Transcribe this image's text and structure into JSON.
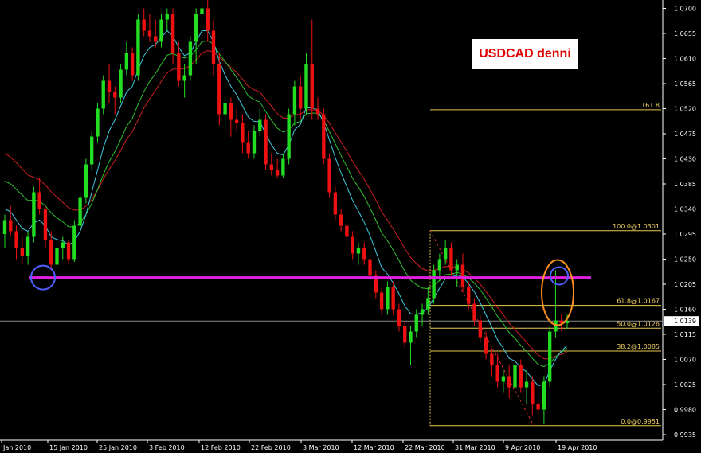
{
  "chart_data": {
    "type": "candlestick",
    "title": "USDCAD denni",
    "y_axis": {
      "ylim": [
        0.9925,
        1.0715
      ],
      "ticks": [
        "1.0700",
        "1.0655",
        "1.0610",
        "1.0565",
        "1.0520",
        "1.0475",
        "1.0430",
        "1.0385",
        "1.0340",
        "1.0295",
        "1.0250",
        "1.0205",
        "1.0160",
        "1.0115",
        "1.0070",
        "1.0025",
        "0.9980",
        "0.9935"
      ]
    },
    "x_axis": {
      "labels": [
        "Jan 2010",
        "15 Jan 2010",
        "25 Jan 2010",
        "3 Feb 2010",
        "12 Feb 2010",
        "22 Feb 2010",
        "3 Mar 2010",
        "12 Mar 2010",
        "22 Mar 2010",
        "31 Mar 2010",
        "9 Apr 2010",
        "19 Apr 2010"
      ]
    },
    "colors": {
      "up": "#22dd22",
      "down": "#ee1111",
      "support": "#e020e0",
      "fib": "#e8c850",
      "ema_fast": "#40c8e0",
      "ema_mid": "#30c030",
      "ema_slow": "#cc2020"
    },
    "candles": [
      [
        1.0295,
        1.033,
        1.027,
        1.032
      ],
      [
        1.032,
        1.0345,
        1.029,
        1.03
      ],
      [
        1.03,
        1.031,
        1.025,
        1.027
      ],
      [
        1.027,
        1.029,
        1.024,
        1.0255
      ],
      [
        1.0255,
        1.03,
        1.024,
        1.029
      ],
      [
        1.029,
        1.038,
        1.028,
        1.037
      ],
      [
        1.037,
        1.0395,
        1.033,
        1.034
      ],
      [
        1.034,
        1.0345,
        1.027,
        1.0285
      ],
      [
        1.0285,
        1.03,
        1.023,
        1.024
      ],
      [
        1.024,
        1.028,
        1.0225,
        1.027
      ],
      [
        1.027,
        1.029,
        1.025,
        1.028
      ],
      [
        1.028,
        1.0285,
        1.024,
        1.025
      ],
      [
        1.025,
        1.032,
        1.0245,
        1.031
      ],
      [
        1.031,
        1.037,
        1.03,
        1.036
      ],
      [
        1.036,
        1.043,
        1.035,
        1.042
      ],
      [
        1.042,
        1.048,
        1.041,
        1.047
      ],
      [
        1.047,
        1.053,
        1.046,
        1.052
      ],
      [
        1.052,
        1.058,
        1.051,
        1.057
      ],
      [
        1.057,
        1.06,
        1.053,
        1.055
      ],
      [
        1.055,
        1.056,
        1.051,
        1.054
      ],
      [
        1.054,
        1.06,
        1.053,
        1.059
      ],
      [
        1.059,
        1.064,
        1.058,
        1.062
      ],
      [
        1.062,
        1.063,
        1.057,
        1.058
      ],
      [
        1.058,
        1.069,
        1.057,
        1.068
      ],
      [
        1.068,
        1.07,
        1.065,
        1.066
      ],
      [
        1.066,
        1.069,
        1.064,
        1.065
      ],
      [
        1.065,
        1.068,
        1.063,
        1.064
      ],
      [
        1.064,
        1.069,
        1.063,
        1.068
      ],
      [
        1.068,
        1.07,
        1.066,
        1.069
      ],
      [
        1.069,
        1.07,
        1.06,
        1.062
      ],
      [
        1.062,
        1.064,
        1.056,
        1.057
      ],
      [
        1.057,
        1.06,
        1.054,
        1.058
      ],
      [
        1.058,
        1.065,
        1.057,
        1.064
      ],
      [
        1.064,
        1.07,
        1.06,
        1.069
      ],
      [
        1.069,
        1.071,
        1.066,
        1.07
      ],
      [
        1.07,
        1.0715,
        1.064,
        1.066
      ],
      [
        1.066,
        1.068,
        1.058,
        1.06
      ],
      [
        1.06,
        1.062,
        1.049,
        1.051
      ],
      [
        1.051,
        1.054,
        1.048,
        1.053
      ],
      [
        1.053,
        1.054,
        1.047,
        1.05
      ],
      [
        1.05,
        1.052,
        1.048,
        1.0495
      ],
      [
        1.0495,
        1.051,
        1.044,
        1.046
      ],
      [
        1.046,
        1.048,
        1.043,
        1.044
      ],
      [
        1.044,
        1.049,
        1.043,
        1.048
      ],
      [
        1.048,
        1.052,
        1.047,
        1.05
      ],
      [
        1.05,
        1.051,
        1.041,
        1.042
      ],
      [
        1.042,
        1.044,
        1.04,
        1.041
      ],
      [
        1.041,
        1.043,
        1.0395,
        1.04
      ],
      [
        1.04,
        1.044,
        1.0395,
        1.043
      ],
      [
        1.043,
        1.052,
        1.042,
        1.051
      ],
      [
        1.051,
        1.057,
        1.049,
        1.056
      ],
      [
        1.056,
        1.058,
        1.05,
        1.052
      ],
      [
        1.052,
        1.062,
        1.051,
        1.06
      ],
      [
        1.06,
        1.068,
        1.05,
        1.052
      ],
      [
        1.052,
        1.054,
        1.05,
        1.051
      ],
      [
        1.051,
        1.052,
        1.042,
        1.043
      ],
      [
        1.043,
        1.044,
        1.036,
        1.037
      ],
      [
        1.037,
        1.038,
        1.032,
        1.033
      ],
      [
        1.033,
        1.034,
        1.03,
        1.031
      ],
      [
        1.031,
        1.032,
        1.028,
        1.029
      ],
      [
        1.029,
        1.03,
        1.025,
        1.026
      ],
      [
        1.026,
        1.028,
        1.024,
        1.027
      ],
      [
        1.027,
        1.028,
        1.024,
        1.025
      ],
      [
        1.025,
        1.026,
        1.021,
        1.022
      ],
      [
        1.022,
        1.023,
        1.018,
        1.019
      ],
      [
        1.019,
        1.02,
        1.015,
        1.016
      ],
      [
        1.016,
        1.021,
        1.015,
        1.02
      ],
      [
        1.02,
        1.021,
        1.015,
        1.016
      ],
      [
        1.016,
        1.017,
        1.012,
        1.013
      ],
      [
        1.013,
        1.014,
        1.009,
        1.01
      ],
      [
        1.01,
        1.013,
        1.006,
        1.012
      ],
      [
        1.012,
        1.016,
        1.011,
        1.015
      ],
      [
        1.015,
        1.017,
        1.013,
        1.016
      ],
      [
        1.016,
        1.02,
        1.015,
        1.018
      ],
      [
        1.018,
        1.024,
        1.017,
        1.023
      ],
      [
        1.023,
        1.026,
        1.021,
        1.025
      ],
      [
        1.025,
        1.0285,
        1.024,
        1.027
      ],
      [
        1.027,
        1.028,
        1.022,
        1.023
      ],
      [
        1.023,
        1.025,
        1.02,
        1.024
      ],
      [
        1.024,
        1.026,
        1.019,
        1.02
      ],
      [
        1.02,
        1.021,
        1.016,
        1.017
      ],
      [
        1.017,
        1.018,
        1.013,
        1.014
      ],
      [
        1.014,
        1.015,
        1.01,
        1.011
      ],
      [
        1.011,
        1.012,
        1.007,
        1.008
      ],
      [
        1.008,
        1.009,
        1.004,
        1.006
      ],
      [
        1.006,
        1.008,
        1.002,
        1.003
      ],
      [
        1.003,
        1.005,
        1.001,
        1.004
      ],
      [
        1.004,
        1.006,
        1.0,
        1.002
      ],
      [
        1.002,
        1.008,
        1.001,
        1.006
      ],
      [
        1.006,
        1.007,
        1.001,
        1.002
      ],
      [
        1.002,
        1.005,
        0.999,
        1.003
      ],
      [
        1.003,
        1.004,
        0.997,
        0.999
      ],
      [
        0.999,
        1.0,
        0.996,
        0.998
      ],
      [
        0.998,
        1.004,
        0.9955,
        1.003
      ],
      [
        1.003,
        1.013,
        1.002,
        1.012
      ],
      [
        1.012,
        1.023,
        1.011,
        1.014
      ],
      [
        1.014,
        1.015,
        1.012,
        1.0135
      ],
      [
        1.0135,
        1.015,
        1.0125,
        1.0139
      ]
    ],
    "ema_fast": [
      1.034,
      1.0335,
      1.032,
      1.0305,
      1.03,
      1.0315,
      1.032,
      1.031,
      1.029,
      1.0285,
      1.0283,
      1.0275,
      1.0282,
      1.03,
      1.033,
      1.037,
      1.041,
      1.045,
      1.048,
      1.05,
      1.0525,
      1.055,
      1.056,
      1.059,
      1.0615,
      1.063,
      1.0635,
      1.0648,
      1.066,
      1.065,
      1.063,
      1.0615,
      1.062,
      1.064,
      1.066,
      1.066,
      1.064,
      1.0605,
      1.058,
      1.056,
      1.0545,
      1.0525,
      1.0505,
      1.0497,
      1.0497,
      1.0475,
      1.0455,
      1.044,
      1.0437,
      1.0455,
      1.0482,
      1.0492,
      1.0522,
      1.0521,
      1.0518,
      1.0495,
      1.0464,
      1.0432,
      1.0405,
      1.038,
      1.0355,
      1.0336,
      1.0316,
      1.0292,
      1.0264,
      1.0235,
      1.0223,
      1.0207,
      1.0188,
      1.0166,
      1.0152,
      1.0151,
      1.0154,
      1.0162,
      1.018,
      1.0198,
      1.0215,
      1.0217,
      1.0222,
      1.0218,
      1.0206,
      1.0191,
      1.0172,
      1.015,
      1.0128,
      1.0105,
      1.009,
      1.0072,
      1.0067,
      1.0055,
      1.0048,
      1.0035,
      1.0023,
      1.0025,
      1.005,
      1.007,
      1.0085,
      1.0095
    ],
    "ema_mid": [
      1.039,
      1.0385,
      1.0375,
      1.0365,
      1.0355,
      1.0356,
      1.0354,
      1.0346,
      1.0333,
      1.0324,
      1.0317,
      1.0308,
      1.0308,
      1.0315,
      1.033,
      1.035,
      1.0375,
      1.0402,
      1.0425,
      1.0443,
      1.0465,
      1.0488,
      1.0503,
      1.0528,
      1.0551,
      1.0569,
      1.0583,
      1.06,
      1.0616,
      1.0619,
      1.0614,
      1.0611,
      1.0614,
      1.0626,
      1.064,
      1.0642,
      1.0636,
      1.0618,
      1.0605,
      1.059,
      1.0576,
      1.056,
      1.0543,
      1.0536,
      1.0532,
      1.0515,
      1.0499,
      1.0485,
      1.0478,
      1.0482,
      1.0494,
      1.0497,
      1.0511,
      1.0512,
      1.0512,
      1.0499,
      1.0479,
      1.0457,
      1.0436,
      1.0416,
      1.0395,
      1.0379,
      1.0362,
      1.0342,
      1.032,
      1.0297,
      1.0283,
      1.0266,
      1.0248,
      1.0228,
      1.0212,
      1.0204,
      1.0198,
      1.0197,
      1.0203,
      1.0212,
      1.0222,
      1.0223,
      1.0226,
      1.0223,
      1.0216,
      1.0207,
      1.0195,
      1.018,
      1.0164,
      1.0147,
      1.0134,
      1.0118,
      1.0108,
      1.0095,
      1.0084,
      1.0072,
      1.0061,
      1.0057,
      1.0063,
      1.0075,
      1.0083,
      1.009
    ],
    "ema_slow": [
      1.044,
      1.0433,
      1.0423,
      1.0412,
      1.0401,
      1.0397,
      1.0392,
      1.0383,
      1.0371,
      1.0361,
      1.0352,
      1.0342,
      1.0338,
      1.0338,
      1.0345,
      1.0357,
      1.0374,
      1.0394,
      1.0411,
      1.0427,
      1.0445,
      1.0465,
      1.0479,
      1.05,
      1.0521,
      1.0538,
      1.0553,
      1.0569,
      1.0584,
      1.0591,
      1.0591,
      1.0592,
      1.0597,
      1.0608,
      1.062,
      1.0624,
      1.0622,
      1.0612,
      1.0604,
      1.0594,
      1.0585,
      1.0573,
      1.056,
      1.0554,
      1.055,
      1.0537,
      1.0524,
      1.0511,
      1.0503,
      1.0503,
      1.0509,
      1.051,
      1.0518,
      1.0518,
      1.0517,
      1.0508,
      1.0494,
      1.0477,
      1.046,
      1.0443,
      1.0425,
      1.0409,
      1.0393,
      1.0375,
      1.0356,
      1.0335,
      1.032,
      1.0304,
      1.0287,
      1.0269,
      1.0253,
      1.0242,
      1.0233,
      1.0229,
      1.023,
      1.0233,
      1.0237,
      1.0236,
      1.0236,
      1.0232,
      1.0225,
      1.0216,
      1.0205,
      1.0192,
      1.0178,
      1.0163,
      1.015,
      1.0135,
      1.0124,
      1.0112,
      1.0101,
      1.0089,
      1.0078,
      1.0071,
      1.0071,
      1.0076,
      1.0079,
      1.0083
    ],
    "support_level": 1.0217,
    "fib_levels": [
      {
        "label": "161.8",
        "value": 1.0518
      },
      {
        "label": "100.0@1.0301",
        "value": 1.0301
      },
      {
        "label": "61.8@1.0167",
        "value": 1.0167
      },
      {
        "label": "50.0@1.0126",
        "value": 1.0126
      },
      {
        "label": "38.2@1.0085",
        "value": 1.0085
      },
      {
        "label": "0.0@0.9951",
        "value": 0.9951
      }
    ],
    "current_price": 1.0139,
    "current_price_label": "1.0139"
  }
}
